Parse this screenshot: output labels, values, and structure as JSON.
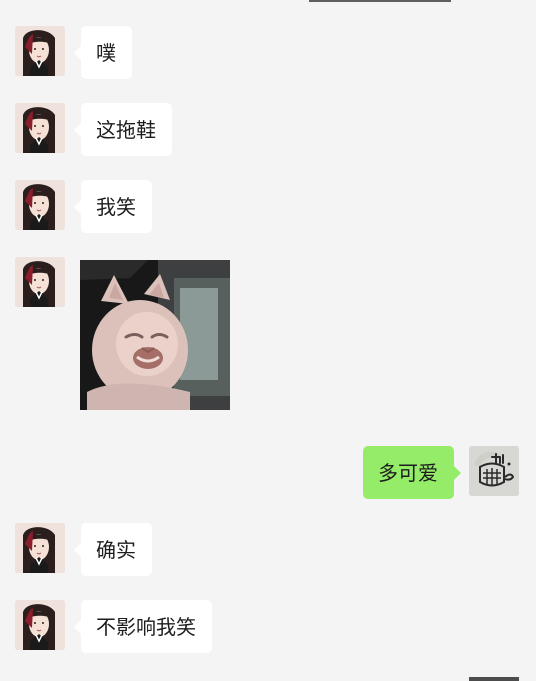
{
  "messages": [
    {
      "side": "left",
      "text": "噗"
    },
    {
      "side": "left",
      "text": "这拖鞋"
    },
    {
      "side": "left",
      "text": "我笑"
    },
    {
      "side": "left",
      "type": "sticker",
      "sticker": "cat-laughing-sticker"
    },
    {
      "side": "right",
      "text": "多可爱"
    },
    {
      "side": "left",
      "text": "确实"
    },
    {
      "side": "left",
      "text": "不影响我笑"
    }
  ]
}
